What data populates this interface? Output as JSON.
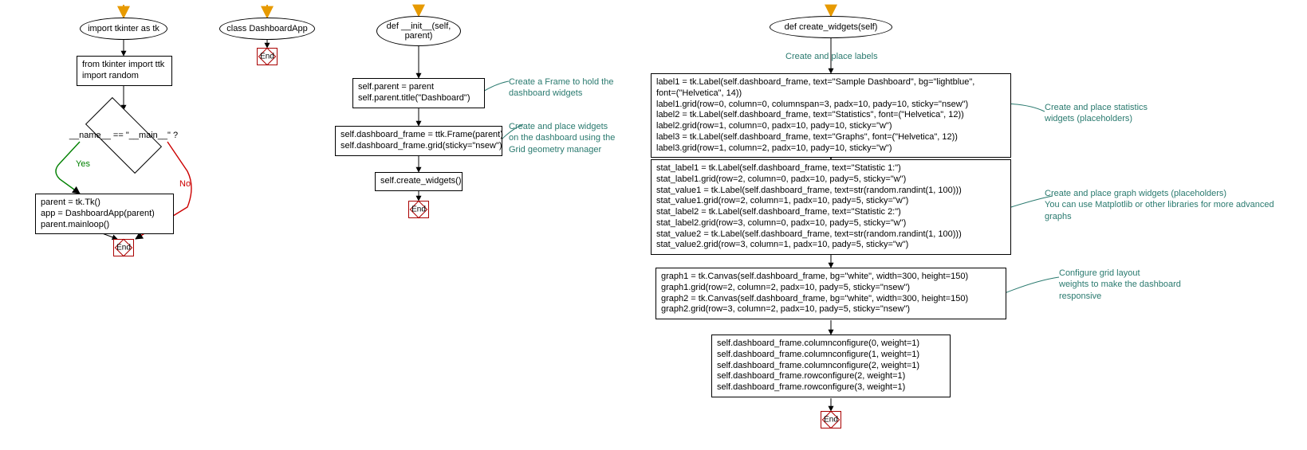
{
  "col1": {
    "oval": "import tkinter as tk",
    "box1": "from tkinter import ttk\nimport random",
    "decision": "__name__ == \"__main__\" ?",
    "yes": "Yes",
    "no": "No",
    "box2": "parent = tk.Tk()\napp = DashboardApp(parent)\nparent.mainloop()",
    "end": "End"
  },
  "col2": {
    "oval": "class DashboardApp",
    "end": "End"
  },
  "col3": {
    "oval": "def __init__(self,\nparent)",
    "box1": "self.parent = parent\nself.parent.title(\"Dashboard\")",
    "box2": "self.dashboard_frame = ttk.Frame(parent)\nself.dashboard_frame.grid(sticky=\"nsew\")",
    "box3": "self.create_widgets()",
    "end": "End",
    "comment1": "Create a Frame to hold the\ndashboard widgets",
    "comment2": "Create and place widgets\non the dashboard using the\nGrid geometry manager"
  },
  "col4": {
    "oval": "def create_widgets(self)",
    "comment_top": "Create and place labels",
    "box1": "label1 = tk.Label(self.dashboard_frame, text=\"Sample Dashboard\", bg=\"lightblue\",\nfont=(\"Helvetica\", 14))\nlabel1.grid(row=0, column=0, columnspan=3, padx=10, pady=10, sticky=\"nsew\")\nlabel2 = tk.Label(self.dashboard_frame, text=\"Statistics\", font=(\"Helvetica\", 12))\nlabel2.grid(row=1, column=0, padx=10, pady=10, sticky=\"w\")\nlabel3 = tk.Label(self.dashboard_frame, text=\"Graphs\", font=(\"Helvetica\", 12))\nlabel3.grid(row=1, column=2, padx=10, pady=10, sticky=\"w\")",
    "comment_b1": "Create and place statistics\nwidgets (placeholders)",
    "box2": "stat_label1 = tk.Label(self.dashboard_frame, text=\"Statistic 1:\")\nstat_label1.grid(row=2, column=0, padx=10, pady=5, sticky=\"w\")\nstat_value1 = tk.Label(self.dashboard_frame, text=str(random.randint(1, 100)))\nstat_value1.grid(row=2, column=1, padx=10, pady=5, sticky=\"w\")\nstat_label2 = tk.Label(self.dashboard_frame, text=\"Statistic 2:\")\nstat_label2.grid(row=3, column=0, padx=10, pady=5, sticky=\"w\")\nstat_value2 = tk.Label(self.dashboard_frame, text=str(random.randint(1, 100)))\nstat_value2.grid(row=3, column=1, padx=10, pady=5, sticky=\"w\")",
    "comment_b2": "Create and place graph widgets (placeholders)\nYou can use Matplotlib or other libraries for more advanced\ngraphs",
    "box3": "graph1 = tk.Canvas(self.dashboard_frame, bg=\"white\", width=300, height=150)\ngraph1.grid(row=2, column=2, padx=10, pady=5, sticky=\"nsew\")\ngraph2 = tk.Canvas(self.dashboard_frame, bg=\"white\", width=300, height=150)\ngraph2.grid(row=3, column=2, padx=10, pady=5, sticky=\"nsew\")",
    "comment_b3": "Configure grid layout\nweights to make the dashboard\nresponsive",
    "box4": "self.dashboard_frame.columnconfigure(0, weight=1)\nself.dashboard_frame.columnconfigure(1, weight=1)\nself.dashboard_frame.columnconfigure(2, weight=1)\nself.dashboard_frame.rowconfigure(2, weight=1)\nself.dashboard_frame.rowconfigure(3, weight=1)",
    "end": "End"
  }
}
